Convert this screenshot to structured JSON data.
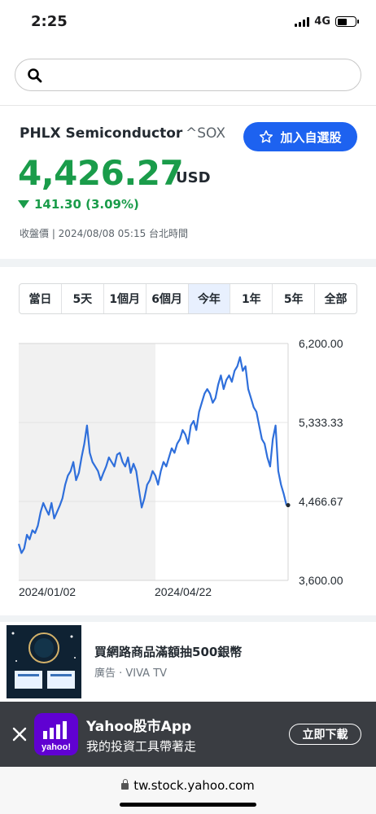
{
  "status_bar": {
    "time": "2:25",
    "network": "4G"
  },
  "search": {
    "placeholder": ""
  },
  "quote": {
    "name": "PHLX Semiconductor",
    "symbol": "^SOX",
    "watch_button": "加入自選股",
    "price": "4,426.27",
    "currency": "USD",
    "change": "141.30 (3.09%)",
    "close_info": "收盤價 | 2024/08/08 05:15 台北時間",
    "color_down": "#1a9c4a"
  },
  "range_tabs": [
    {
      "label": "當日"
    },
    {
      "label": "5天"
    },
    {
      "label": "1個月"
    },
    {
      "label": "6個月"
    },
    {
      "label": "今年",
      "active": true
    },
    {
      "label": "1年"
    },
    {
      "label": "5年"
    },
    {
      "label": "全部"
    }
  ],
  "chart_data": {
    "type": "line",
    "y_ticks": [
      "6,200.00",
      "5,333.33",
      "4,466.67",
      "3,600.00"
    ],
    "x_ticks": [
      "2024/01/02",
      "2024/04/22"
    ],
    "ylim": [
      3600,
      6200
    ],
    "line_color": "#2f6fdb",
    "series": [
      {
        "values": [
          4000,
          3900,
          3950,
          4100,
          4050,
          4150,
          4120,
          4200,
          4350,
          4450,
          4380,
          4320,
          4450,
          4280,
          4350,
          4420,
          4500,
          4650,
          4750,
          4800,
          4900,
          4700,
          4780,
          4950,
          5100,
          5300,
          5000,
          4900,
          4850,
          4800,
          4700,
          4780,
          4850,
          4950,
          4900,
          4850,
          4980,
          5000,
          4900,
          4850,
          4950,
          4780,
          4880,
          4800,
          4600,
          4400,
          4500,
          4650,
          4700,
          4800,
          4750,
          4650,
          4800,
          4900,
          4850,
          4950,
          5050,
          5000,
          5100,
          5150,
          5250,
          5200,
          5100,
          5300,
          5350,
          5250,
          5450,
          5550,
          5650,
          5700,
          5650,
          5550,
          5600,
          5750,
          5850,
          5700,
          5800,
          5850,
          5780,
          5900,
          5950,
          6050,
          5900,
          5950,
          5700,
          5600,
          5500,
          5450,
          5300,
          5150,
          5100,
          4950,
          4850,
          5150,
          5300,
          4800,
          4650,
          4550,
          4426
        ]
      }
    ]
  },
  "ad": {
    "title": "買網路商品滿額抽500銀幣",
    "sponsor": "廣告 · VIVA TV"
  },
  "banner": {
    "app_name": "Yahoo股市App",
    "tagline": "我的投資工具帶著走",
    "download_button": "立即下載",
    "logo_text": "yahoo!"
  },
  "url_bar": {
    "url": "tw.stock.yahoo.com"
  }
}
